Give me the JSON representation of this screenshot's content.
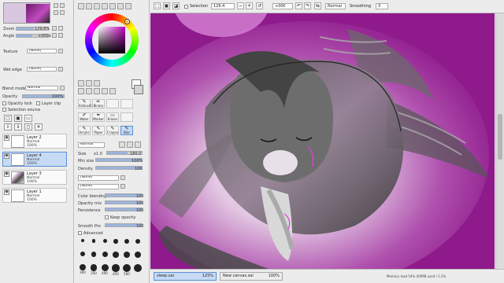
{
  "navigator": {
    "zoom_label": "Zoom",
    "zoom_value": "129.8%",
    "angle_label": "Angle",
    "angle_value": "+000$"
  },
  "paper": {
    "texture_label": "Texture",
    "texture_value": "[None]",
    "wetedge_label": "Wet edge",
    "wetedge_value": "[None]"
  },
  "layer_panel": {
    "blend_mode_label": "Blend mode",
    "blend_mode_value": "Normal",
    "opacity_label": "Opacity",
    "opacity_value": "100%",
    "opacity_fraction": 1.0,
    "opacity_lock_label": "Opacity lock",
    "layer_clip_label": "Layer clip",
    "selection_source_label": "Selection source",
    "layers": [
      {
        "name": "Layer 2",
        "mode": "Normal",
        "opacity": "100%",
        "selected": false,
        "art": false
      },
      {
        "name": "Layer 4",
        "mode": "Normal",
        "opacity": "100%",
        "selected": true,
        "art": false
      },
      {
        "name": "Layer 3",
        "mode": "Normal",
        "opacity": "100%",
        "selected": false,
        "art": true
      },
      {
        "name": "Layer 1",
        "mode": "Normal",
        "opacity": "100%",
        "selected": false,
        "art": false
      }
    ]
  },
  "tools": {
    "row1": [
      {
        "label": "Airbrush",
        "glyph": "✎"
      },
      {
        "label": "Binary",
        "glyph": "✏"
      },
      {
        "label": "",
        "glyph": ""
      },
      {
        "label": "",
        "glyph": ""
      }
    ],
    "row2": [
      {
        "label": "Water",
        "glyph": "✐"
      },
      {
        "label": "Marker",
        "glyph": "✒"
      },
      {
        "label": "Eraser",
        "glyph": "▭"
      },
      {
        "label": "",
        "glyph": ""
      }
    ],
    "row3": [
      {
        "label": "Acrylic",
        "glyph": "✎"
      },
      {
        "label": "Paper",
        "glyph": "✎"
      },
      {
        "label": "Crayon",
        "glyph": "✎"
      },
      {
        "label": "Blur",
        "glyph": "✎"
      }
    ]
  },
  "brush_settings": {
    "mode_value": "Normal",
    "size_label": "Size",
    "size_mult": "x1.0",
    "size_value": "180.0",
    "minsize_label": "Min size",
    "minsize_value": "100%",
    "density_label": "Density",
    "density_value": "100",
    "shape_value": "[None]",
    "texture_value": "[None]",
    "colorblend_label": "Color blending",
    "colorblend_value": "100",
    "opacitymix_label": "Opacity mix",
    "opacitymix_value": "100",
    "persistence_label": "Persistence",
    "persistence_value": "100",
    "keepopacity_label": "Keep opacity",
    "smoothpro_label": "Smooth Pro",
    "smoothpro_value": "100",
    "advanced_label": "Advanced",
    "sizes_row1": [
      "",
      "",
      "",
      "",
      "",
      ""
    ],
    "sizes_row2": [
      "",
      "",
      "",
      "",
      "",
      ""
    ],
    "sizes_row3": [
      "300",
      "350",
      "400",
      "450",
      "500",
      ""
    ]
  },
  "toolbar": {
    "selection_label": "Selection",
    "zoom_value": "126.4",
    "angle_value": "+00€",
    "blend_value": "Normal",
    "smoothing_label": "Smoothing",
    "smoothing_value": "3"
  },
  "docs": [
    {
      "name": "sleep.sai",
      "pct": "125%",
      "selected": true
    },
    {
      "name": "New canvas.sai",
      "pct": "100%",
      "selected": false
    }
  ],
  "status_text": "Memory load 54% (65MB used / 1.2%",
  "colors": {
    "canvas_bg": "#8e1a8c",
    "selection": "#c7daf5",
    "accent": "#5b8fd8"
  }
}
